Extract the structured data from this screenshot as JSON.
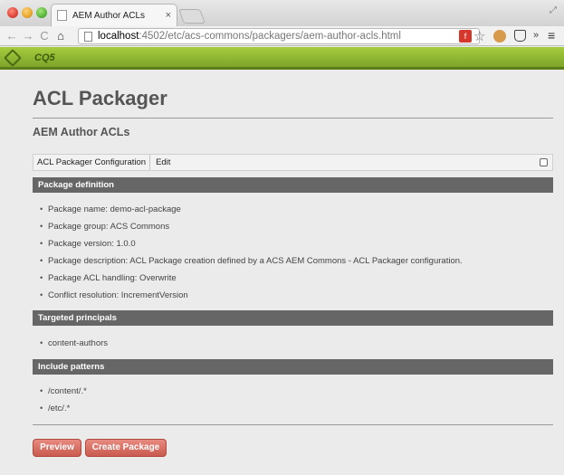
{
  "browser": {
    "tab_title": "AEM Author ACLs",
    "tab_close": "×",
    "url_host": "localhost",
    "url_rest": ":4502/etc/acs-commons/packagers/aem-author-acls.html",
    "back_glyph": "←",
    "forward_glyph": "→",
    "reload_glyph": "C",
    "home_glyph": "⌂",
    "star_glyph": "☆",
    "more_glyph": "»",
    "menu_glyph": "≡",
    "fullscreen_glyph": "⤢"
  },
  "app_bar": {
    "logo_text": "CQ5",
    "accent": "#93bb34"
  },
  "page": {
    "title": "ACL Packager",
    "subtitle": "AEM Author ACLs",
    "config_label": "ACL Packager Configuration",
    "config_edit": "Edit"
  },
  "sections": {
    "definition": {
      "heading": "Package definition",
      "items": [
        "Package name: demo-acl-package",
        "Package group: ACS Commons",
        "Package version: 1.0.0",
        "Package description: ACL Package creation defined by a ACS AEM Commons - ACL Packager configuration.",
        "Package ACL handling: Overwrite",
        "Conflict resolution: IncrementVersion"
      ]
    },
    "principals": {
      "heading": "Targeted principals",
      "items": [
        "content-authors"
      ]
    },
    "patterns": {
      "heading": "Include patterns",
      "items": [
        "/content/.*",
        "/etc/.*"
      ]
    }
  },
  "buttons": {
    "preview": "Preview",
    "create": "Create Package",
    "color": "#d9685d"
  }
}
